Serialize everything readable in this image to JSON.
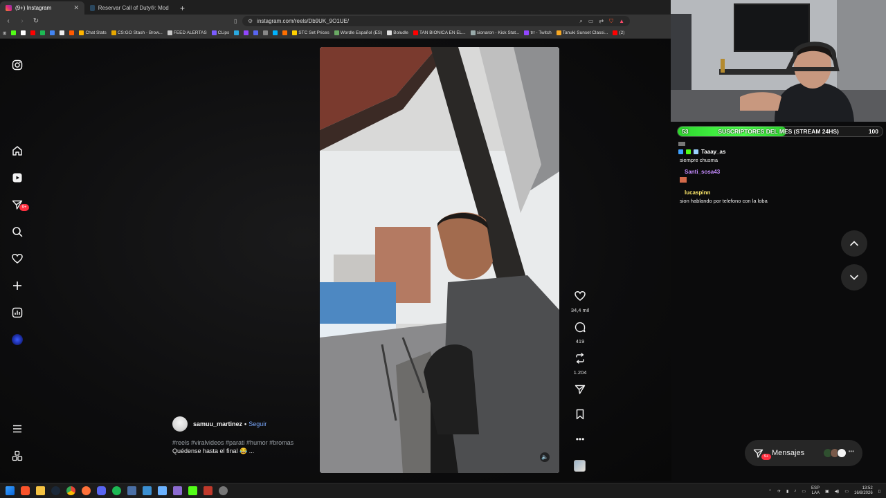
{
  "browser": {
    "tabs": [
      {
        "label": "(9+) Instagram",
        "active": true
      },
      {
        "label": "Reservar Call of Duty®: Modern War...",
        "active": false
      }
    ],
    "new_tab": "+",
    "url": "instagram.com/reels/Db9UK_9O1UE/",
    "bookmarks": [
      "Chat Stats",
      "CS:GO Stash - Brow...",
      "FEED ALERTAS",
      "CLips",
      "STC Set Prices",
      "Wordle Español (ES)",
      "Boludle",
      "TAN BIONICA EN EL...",
      "sionaron - Kick Stat...",
      "trr - Twitch",
      "Tanuki Sunset Classi...",
      "(2)"
    ]
  },
  "reel": {
    "likes": "34,4 mil",
    "comments": "419",
    "reposts": "1.204",
    "author": "samuu_martinez",
    "follow_label": "Seguir",
    "separator": "•",
    "hashtags": "#reels #viralvideos #parati #humor #bromas",
    "caption": "Quédense hasta el final 😂 ..."
  },
  "sidebar": {
    "notif_badge": "9+"
  },
  "messages": {
    "label": "Mensajes",
    "badge": "9+"
  },
  "stream": {
    "sub_count_left": "53",
    "sub_title": "SUSCRIPTORES DEL MES (STREAM 24HS)",
    "sub_goal": "100",
    "sub_progress": 0.53,
    "chat": [
      {
        "user": "Taaay_as",
        "text": "siempre chusma",
        "color": "#ffffff"
      },
      {
        "user": "Santi_sosa43",
        "text": "",
        "color": "#c58cff"
      },
      {
        "user": "lucaspinn",
        "text": "sion hablando por telefono con la loba",
        "color": "#ffe96b"
      }
    ]
  },
  "taskbar": {
    "lang": "ESP",
    "lang2": "LAA",
    "time": "13:52",
    "date": "16/8/2026"
  },
  "colors": {
    "instagram_bg": "#0d0d0e",
    "accent_blue": "#7aa9ff",
    "badge_red": "#ff3040",
    "sub_green": "#3ee43e"
  }
}
